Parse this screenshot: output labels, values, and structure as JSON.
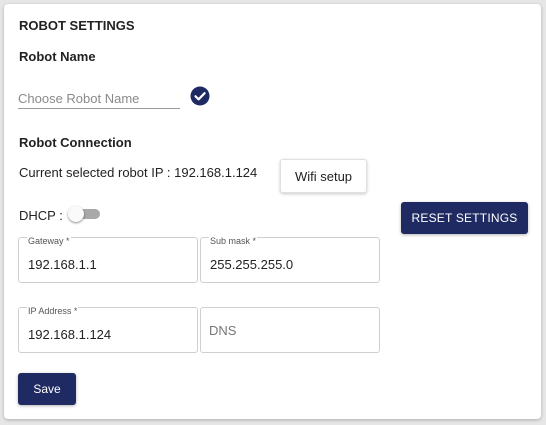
{
  "header": {
    "title": "ROBOT SETTINGS"
  },
  "robot_name": {
    "label": "Robot Name",
    "input_placeholder": "Choose Robot Name",
    "input_value": "",
    "confirm_icon": "check-circle-icon"
  },
  "connection": {
    "label": "Robot Connection",
    "current_ip_text": "Current selected robot IP : 192.168.1.124",
    "wifi_button": "Wifi setup",
    "dhcp_label": "DHCP :",
    "dhcp_enabled": false,
    "reset_button": "RESET SETTINGS"
  },
  "fields": {
    "gateway": {
      "label": "Gateway *",
      "value": "192.168.1.1"
    },
    "submask": {
      "label": "Sub mask *",
      "value": "255.255.255.0"
    },
    "ip_address": {
      "label": "IP Address *",
      "value": "192.168.1.124"
    },
    "dns": {
      "placeholder": "DNS",
      "value": ""
    }
  },
  "footer": {
    "save_button": "Save"
  },
  "colors": {
    "primary": "#1f2a63",
    "toggle_track": "#a8a8a8"
  }
}
